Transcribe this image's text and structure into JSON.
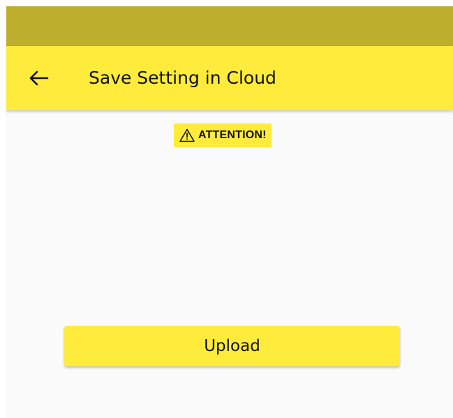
{
  "colors": {
    "status_bar": "#bdaf2d",
    "accent": "#ffeb3b",
    "background": "#fafafa",
    "text": "#111111"
  },
  "status_bar": {},
  "app_bar": {
    "back_icon": "arrow-back-icon",
    "title": "Save Setting in Cloud"
  },
  "attention": {
    "icon": "warning-icon",
    "label": "ATTENTION!"
  },
  "actions": {
    "upload_label": "Upload"
  }
}
